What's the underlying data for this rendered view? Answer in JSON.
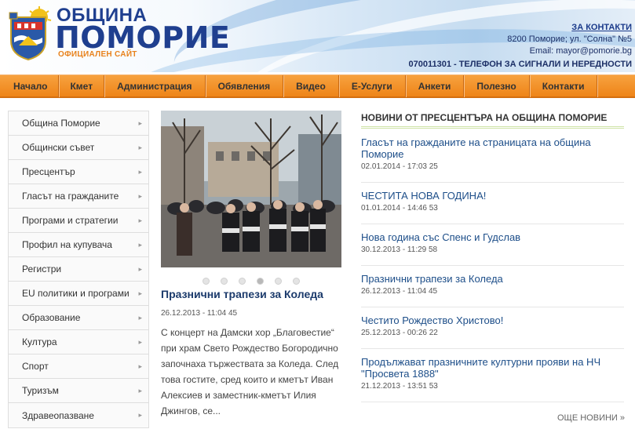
{
  "header": {
    "logo": {
      "line1": "ОБЩИНА",
      "line2": "ПОМОРИЕ",
      "line3": "ОФИЦИАЛЕН САЙТ"
    },
    "contacts": {
      "link": "ЗА КОНТАКТИ",
      "address": "8200 Поморие; ул. \"Солна\" №5",
      "email": "Email: mayor@pomorie.bg",
      "phone": "070011301 - ТЕЛЕФОН ЗА СИГНАЛИ И НЕРЕДНОСТИ"
    }
  },
  "nav": [
    "Начало",
    "Кмет",
    "Администрация",
    "Обявления",
    "Видео",
    "Е-Услуги",
    "Анкети",
    "Полезно",
    "Контакти"
  ],
  "sidebar": [
    "Община Поморие",
    "Общински съвет",
    "Пресцентър",
    "Гласът на гражданите",
    "Програми и стратегии",
    "Профил на купувача",
    "Регистри",
    "EU политики и програми",
    "Образование",
    "Култура",
    "Спорт",
    "Туризъм",
    "Здравеопазване"
  ],
  "featured": {
    "title": "Празнични трапези за Коледа",
    "date": "26.12.2013 - 11:04 45",
    "text": "С концерт на Дамски хор „Благовестие“ при храм Свето Рождество Богородично започнаха тържествата за Коледа. След това гостите, сред които и кметът Иван Алексиев и заместник-кметът Илия Джингов, се...",
    "slides": 6,
    "active_slide": 4
  },
  "news": {
    "heading": "НОВИНИ ОТ ПРЕСЦЕНТЪРА НА ОБЩИНА ПОМОРИЕ",
    "items": [
      {
        "title": "Гласът на гражданите на страницата на община Поморие",
        "date": "02.01.2014 - 17:03 25"
      },
      {
        "title": "ЧЕСТИТА НОВА ГОДИНА!",
        "date": "01.01.2014 - 14:46 53"
      },
      {
        "title": "Нова година със Спенс и Гудслав",
        "date": "30.12.2013 - 11:29 58"
      },
      {
        "title": "Празнични трапези за Коледа",
        "date": "26.12.2013 - 11:04 45"
      },
      {
        "title": "Честито Рождество Христово!",
        "date": "25.12.2013 - 00:26 22"
      },
      {
        "title": "Продължават празничните културни прояви на НЧ \"Просвета 1888\"",
        "date": "21.12.2013 - 13:51 53"
      }
    ],
    "more": "ОЩЕ НОВИНИ »"
  },
  "colors": {
    "nav": "#ee8418",
    "link": "#1d4e89",
    "brand": "#1f3f8f",
    "accent": "#e8821c"
  }
}
